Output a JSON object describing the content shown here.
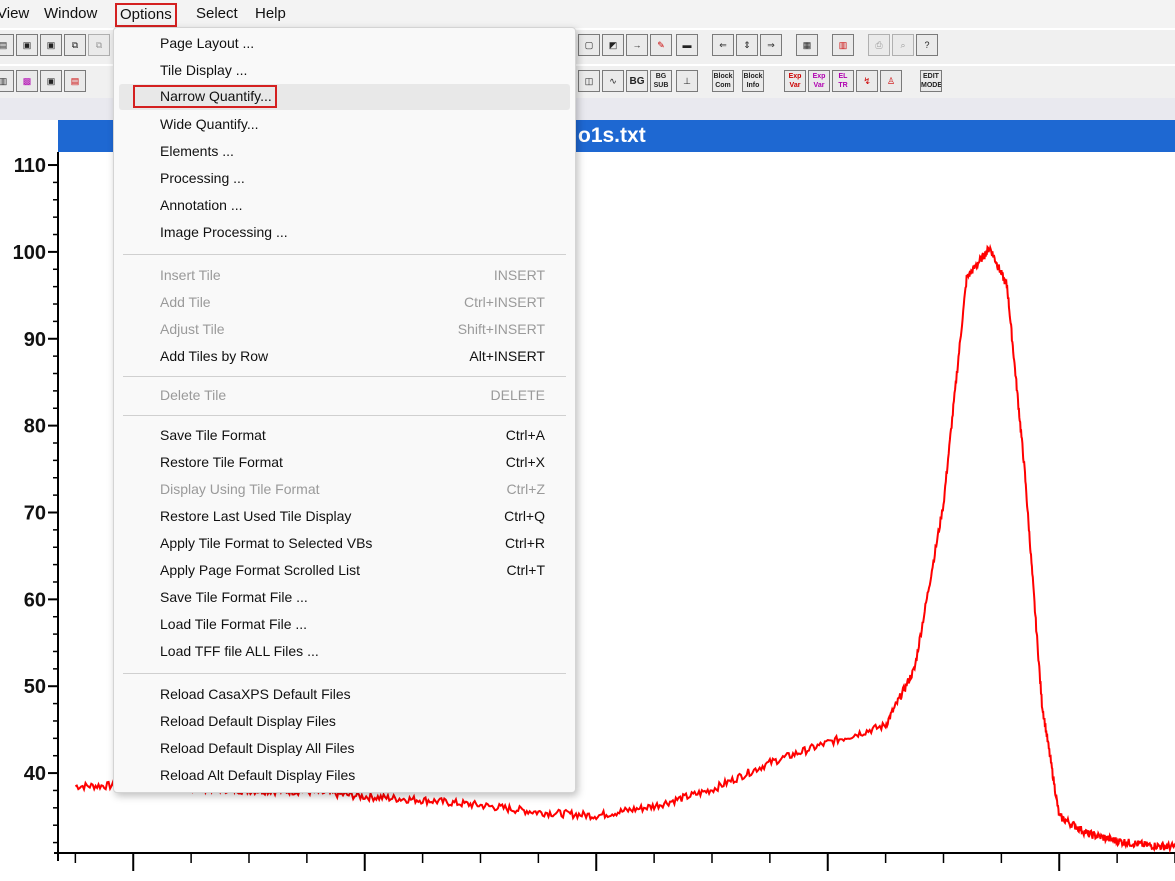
{
  "menubar": {
    "items": [
      {
        "label": "View"
      },
      {
        "label": "Window"
      },
      {
        "label": "Options"
      },
      {
        "label": "Select"
      },
      {
        "label": "Help"
      }
    ]
  },
  "window": {
    "title_visible": "o1s.txt"
  },
  "options_menu": {
    "items": [
      {
        "label": "Page Layout ...",
        "shortcut": "",
        "enabled": true
      },
      {
        "label": "Tile Display ...",
        "shortcut": "",
        "enabled": true
      },
      {
        "label": "Narrow Quantify...",
        "shortcut": "",
        "enabled": true,
        "highlighted": true
      },
      {
        "label": "Wide Quantify...",
        "shortcut": "",
        "enabled": true
      },
      {
        "label": "Elements ...",
        "shortcut": "",
        "enabled": true
      },
      {
        "label": "Processing ...",
        "shortcut": "",
        "enabled": true
      },
      {
        "label": "Annotation ...",
        "shortcut": "",
        "enabled": true
      },
      {
        "label": "Image Processing ...",
        "shortcut": "",
        "enabled": true
      },
      {
        "label": "Insert Tile",
        "shortcut": "INSERT",
        "enabled": false
      },
      {
        "label": "Add Tile",
        "shortcut": "Ctrl+INSERT",
        "enabled": false
      },
      {
        "label": "Adjust Tile",
        "shortcut": "Shift+INSERT",
        "enabled": false
      },
      {
        "label": "Add Tiles by Row",
        "shortcut": "Alt+INSERT",
        "enabled": true
      },
      {
        "label": "Delete Tile",
        "shortcut": "DELETE",
        "enabled": false
      },
      {
        "label": "Save Tile Format",
        "shortcut": "Ctrl+A",
        "enabled": true
      },
      {
        "label": "Restore Tile Format",
        "shortcut": "Ctrl+X",
        "enabled": true
      },
      {
        "label": "Display Using Tile Format",
        "shortcut": "Ctrl+Z",
        "enabled": false
      },
      {
        "label": "Restore Last Used Tile Display",
        "shortcut": "Ctrl+Q",
        "enabled": true
      },
      {
        "label": "Apply Tile Format to Selected VBs",
        "shortcut": "Ctrl+R",
        "enabled": true
      },
      {
        "label": "Apply Page Format Scrolled List",
        "shortcut": "Ctrl+T",
        "enabled": true
      },
      {
        "label": "Save Tile Format File ...",
        "shortcut": "",
        "enabled": true
      },
      {
        "label": "Load Tile Format File ...",
        "shortcut": "",
        "enabled": true
      },
      {
        "label": "Load TFF file ALL Files ...",
        "shortcut": "",
        "enabled": true
      },
      {
        "label": "Reload CasaXPS Default Files",
        "shortcut": "",
        "enabled": true
      },
      {
        "label": "Reload  Default Display Files",
        "shortcut": "",
        "enabled": true
      },
      {
        "label": "Reload  Default Display All Files",
        "shortcut": "",
        "enabled": true
      },
      {
        "label": "Reload Alt Default Display Files",
        "shortcut": "",
        "enabled": true
      }
    ]
  },
  "toolbar": {
    "row2_text_buttons": [
      "BG",
      "BG SUB",
      "Block Com",
      "Block Info",
      "Exp Var",
      "Exp Var",
      "EL TR",
      "EDIT MODE"
    ]
  },
  "chart_data": {
    "type": "line",
    "series": [
      {
        "x": [
          545,
          544,
          543,
          542,
          541,
          540,
          539,
          538,
          537,
          536,
          535,
          534,
          533,
          532,
          531,
          530.5,
          530,
          529.6,
          529.2,
          528.9,
          528.6,
          528.3,
          528,
          527.5,
          527,
          526.5,
          526
        ],
        "y": [
          38.5,
          38.6,
          38.3,
          38,
          37.9,
          37.3,
          36.9,
          36.3,
          35.5,
          35.1,
          36.2,
          38.1,
          41.2,
          43.5,
          45.5,
          52,
          71,
          97,
          100.5,
          96,
          75,
          48,
          35,
          33,
          32.2,
          31.7,
          31.5
        ],
        "color": "#ff0000"
      }
    ],
    "y_ticks": [
      "40",
      "50",
      "60",
      "70",
      "80",
      "90",
      "100",
      "110"
    ],
    "x_ticks": [
      "544",
      "540",
      "536",
      "532",
      "528"
    ],
    "xlim": [
      545.3,
      526.0
    ],
    "ylim": [
      30.8,
      111.5
    ],
    "grid": false
  }
}
